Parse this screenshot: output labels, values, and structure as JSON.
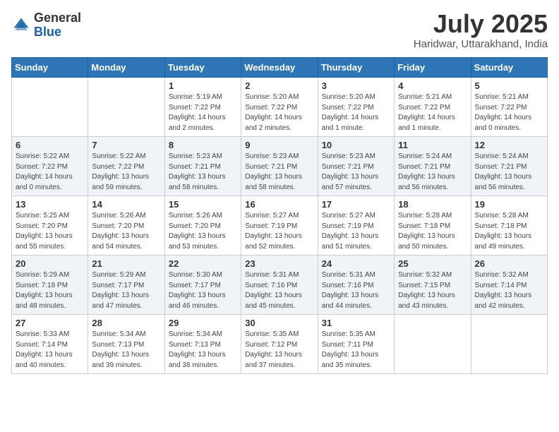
{
  "header": {
    "logo": {
      "general": "General",
      "blue": "Blue"
    },
    "title": "July 2025",
    "location": "Haridwar, Uttarakhand, India"
  },
  "calendar": {
    "days_of_week": [
      "Sunday",
      "Monday",
      "Tuesday",
      "Wednesday",
      "Thursday",
      "Friday",
      "Saturday"
    ],
    "weeks": [
      [
        {
          "day": "",
          "info": ""
        },
        {
          "day": "",
          "info": ""
        },
        {
          "day": "1",
          "info": "Sunrise: 5:19 AM\nSunset: 7:22 PM\nDaylight: 14 hours\nand 2 minutes."
        },
        {
          "day": "2",
          "info": "Sunrise: 5:20 AM\nSunset: 7:22 PM\nDaylight: 14 hours\nand 2 minutes."
        },
        {
          "day": "3",
          "info": "Sunrise: 5:20 AM\nSunset: 7:22 PM\nDaylight: 14 hours\nand 1 minute."
        },
        {
          "day": "4",
          "info": "Sunrise: 5:21 AM\nSunset: 7:22 PM\nDaylight: 14 hours\nand 1 minute."
        },
        {
          "day": "5",
          "info": "Sunrise: 5:21 AM\nSunset: 7:22 PM\nDaylight: 14 hours\nand 0 minutes."
        }
      ],
      [
        {
          "day": "6",
          "info": "Sunrise: 5:22 AM\nSunset: 7:22 PM\nDaylight: 14 hours\nand 0 minutes."
        },
        {
          "day": "7",
          "info": "Sunrise: 5:22 AM\nSunset: 7:22 PM\nDaylight: 13 hours\nand 59 minutes."
        },
        {
          "day": "8",
          "info": "Sunrise: 5:23 AM\nSunset: 7:21 PM\nDaylight: 13 hours\nand 58 minutes."
        },
        {
          "day": "9",
          "info": "Sunrise: 5:23 AM\nSunset: 7:21 PM\nDaylight: 13 hours\nand 58 minutes."
        },
        {
          "day": "10",
          "info": "Sunrise: 5:23 AM\nSunset: 7:21 PM\nDaylight: 13 hours\nand 57 minutes."
        },
        {
          "day": "11",
          "info": "Sunrise: 5:24 AM\nSunset: 7:21 PM\nDaylight: 13 hours\nand 56 minutes."
        },
        {
          "day": "12",
          "info": "Sunrise: 5:24 AM\nSunset: 7:21 PM\nDaylight: 13 hours\nand 56 minutes."
        }
      ],
      [
        {
          "day": "13",
          "info": "Sunrise: 5:25 AM\nSunset: 7:20 PM\nDaylight: 13 hours\nand 55 minutes."
        },
        {
          "day": "14",
          "info": "Sunrise: 5:26 AM\nSunset: 7:20 PM\nDaylight: 13 hours\nand 54 minutes."
        },
        {
          "day": "15",
          "info": "Sunrise: 5:26 AM\nSunset: 7:20 PM\nDaylight: 13 hours\nand 53 minutes."
        },
        {
          "day": "16",
          "info": "Sunrise: 5:27 AM\nSunset: 7:19 PM\nDaylight: 13 hours\nand 52 minutes."
        },
        {
          "day": "17",
          "info": "Sunrise: 5:27 AM\nSunset: 7:19 PM\nDaylight: 13 hours\nand 51 minutes."
        },
        {
          "day": "18",
          "info": "Sunrise: 5:28 AM\nSunset: 7:18 PM\nDaylight: 13 hours\nand 50 minutes."
        },
        {
          "day": "19",
          "info": "Sunrise: 5:28 AM\nSunset: 7:18 PM\nDaylight: 13 hours\nand 49 minutes."
        }
      ],
      [
        {
          "day": "20",
          "info": "Sunrise: 5:29 AM\nSunset: 7:18 PM\nDaylight: 13 hours\nand 48 minutes."
        },
        {
          "day": "21",
          "info": "Sunrise: 5:29 AM\nSunset: 7:17 PM\nDaylight: 13 hours\nand 47 minutes."
        },
        {
          "day": "22",
          "info": "Sunrise: 5:30 AM\nSunset: 7:17 PM\nDaylight: 13 hours\nand 46 minutes."
        },
        {
          "day": "23",
          "info": "Sunrise: 5:31 AM\nSunset: 7:16 PM\nDaylight: 13 hours\nand 45 minutes."
        },
        {
          "day": "24",
          "info": "Sunrise: 5:31 AM\nSunset: 7:16 PM\nDaylight: 13 hours\nand 44 minutes."
        },
        {
          "day": "25",
          "info": "Sunrise: 5:32 AM\nSunset: 7:15 PM\nDaylight: 13 hours\nand 43 minutes."
        },
        {
          "day": "26",
          "info": "Sunrise: 5:32 AM\nSunset: 7:14 PM\nDaylight: 13 hours\nand 42 minutes."
        }
      ],
      [
        {
          "day": "27",
          "info": "Sunrise: 5:33 AM\nSunset: 7:14 PM\nDaylight: 13 hours\nand 40 minutes."
        },
        {
          "day": "28",
          "info": "Sunrise: 5:34 AM\nSunset: 7:13 PM\nDaylight: 13 hours\nand 39 minutes."
        },
        {
          "day": "29",
          "info": "Sunrise: 5:34 AM\nSunset: 7:13 PM\nDaylight: 13 hours\nand 38 minutes."
        },
        {
          "day": "30",
          "info": "Sunrise: 5:35 AM\nSunset: 7:12 PM\nDaylight: 13 hours\nand 37 minutes."
        },
        {
          "day": "31",
          "info": "Sunrise: 5:35 AM\nSunset: 7:11 PM\nDaylight: 13 hours\nand 35 minutes."
        },
        {
          "day": "",
          "info": ""
        },
        {
          "day": "",
          "info": ""
        }
      ]
    ]
  }
}
